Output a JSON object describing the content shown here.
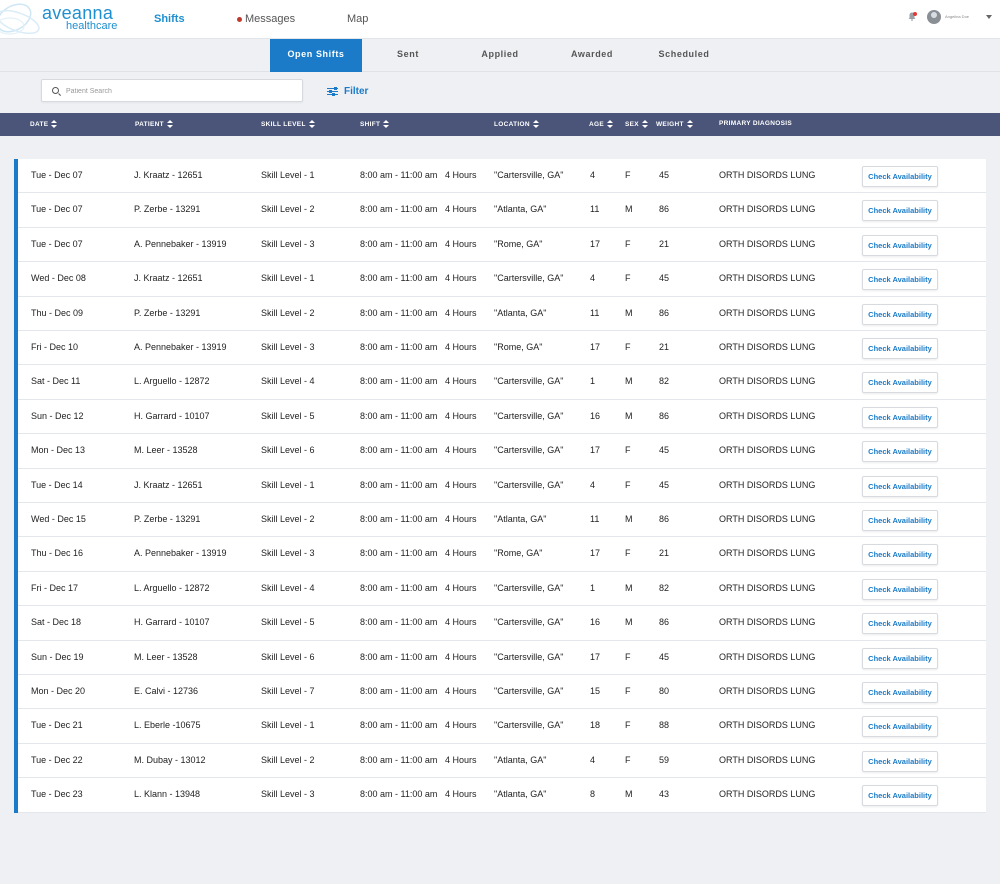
{
  "brand": {
    "name": "aveanna",
    "sub": "healthcare"
  },
  "nav": {
    "shifts": "Shifts",
    "messages": "Messages",
    "map": "Map"
  },
  "user": {
    "name": "Angelina Doe"
  },
  "tabs": [
    "Open Shifts",
    "Sent",
    "Applied",
    "Awarded",
    "Scheduled"
  ],
  "search": {
    "placeholder": "Patient Search",
    "value": ""
  },
  "filter_label": "Filter",
  "columns": [
    "DATE",
    "PATIENT",
    "SKILL LEVEL",
    "SHIFT",
    "LOCATION",
    "AGE",
    "SEX",
    "WEIGHT",
    "PRIMARY DIAGNOSIS"
  ],
  "action_label": "Check Availability",
  "colors": {
    "accent": "#1b7bc8",
    "header": "#4a5579",
    "background": "#eef0f4"
  },
  "rows": [
    {
      "date": "Tue - Dec 07",
      "patient": "J. Kraatz - 12651",
      "skill": "Skill Level - 1",
      "time": "8:00 am - 11:00 am",
      "hours": "4 Hours",
      "location": "\"Cartersville, GA\"",
      "age": "4",
      "sex": "F",
      "weight": "45",
      "diagnosis": "ORTH DISORDS LUNG"
    },
    {
      "date": "Tue - Dec 07",
      "patient": "P. Zerbe - 13291",
      "skill": "Skill Level - 2",
      "time": "8:00 am - 11:00 am",
      "hours": "4 Hours",
      "location": "\"Atlanta, GA\"",
      "age": "11",
      "sex": "M",
      "weight": "86",
      "diagnosis": "ORTH DISORDS LUNG"
    },
    {
      "date": "Tue - Dec 07",
      "patient": "A. Pennebaker - 13919",
      "skill": "Skill Level - 3",
      "time": "8:00 am - 11:00 am",
      "hours": "4 Hours",
      "location": "\"Rome, GA\"",
      "age": "17",
      "sex": "F",
      "weight": "21",
      "diagnosis": "ORTH DISORDS LUNG"
    },
    {
      "date": "Wed - Dec 08",
      "patient": "J. Kraatz - 12651",
      "skill": "Skill Level - 1",
      "time": "8:00 am - 11:00 am",
      "hours": "4 Hours",
      "location": "\"Cartersville, GA\"",
      "age": "4",
      "sex": "F",
      "weight": "45",
      "diagnosis": "ORTH DISORDS LUNG"
    },
    {
      "date": "Thu - Dec 09",
      "patient": "P. Zerbe - 13291",
      "skill": "Skill Level - 2",
      "time": "8:00 am - 11:00 am",
      "hours": "4 Hours",
      "location": "\"Atlanta, GA\"",
      "age": "11",
      "sex": "M",
      "weight": "86",
      "diagnosis": "ORTH DISORDS LUNG"
    },
    {
      "date": "Fri - Dec 10",
      "patient": "A. Pennebaker - 13919",
      "skill": "Skill Level - 3",
      "time": "8:00 am - 11:00 am",
      "hours": "4 Hours",
      "location": "\"Rome, GA\"",
      "age": "17",
      "sex": "F",
      "weight": "21",
      "diagnosis": "ORTH DISORDS LUNG"
    },
    {
      "date": "Sat - Dec 11",
      "patient": "L. Arguello - 12872",
      "skill": "Skill Level - 4",
      "time": "8:00 am - 11:00 am",
      "hours": "4 Hours",
      "location": "\"Cartersville, GA\"",
      "age": "1",
      "sex": "M",
      "weight": "82",
      "diagnosis": "ORTH DISORDS LUNG"
    },
    {
      "date": "Sun - Dec 12",
      "patient": "H. Garrard - 10107",
      "skill": "Skill Level - 5",
      "time": "8:00 am - 11:00 am",
      "hours": "4 Hours",
      "location": "\"Cartersville, GA\"",
      "age": "16",
      "sex": "M",
      "weight": "86",
      "diagnosis": "ORTH DISORDS LUNG"
    },
    {
      "date": "Mon - Dec 13",
      "patient": "M. Leer - 13528",
      "skill": "Skill Level - 6",
      "time": "8:00 am - 11:00 am",
      "hours": "4 Hours",
      "location": "\"Cartersville, GA\"",
      "age": "17",
      "sex": "F",
      "weight": "45",
      "diagnosis": "ORTH DISORDS LUNG"
    },
    {
      "date": "Tue - Dec 14",
      "patient": "J. Kraatz - 12651",
      "skill": "Skill Level - 1",
      "time": "8:00 am - 11:00 am",
      "hours": "4 Hours",
      "location": "\"Cartersville, GA\"",
      "age": "4",
      "sex": "F",
      "weight": "45",
      "diagnosis": "ORTH DISORDS LUNG"
    },
    {
      "date": "Wed - Dec 15",
      "patient": "P. Zerbe - 13291",
      "skill": "Skill Level - 2",
      "time": "8:00 am - 11:00 am",
      "hours": "4 Hours",
      "location": "\"Atlanta, GA\"",
      "age": "11",
      "sex": "M",
      "weight": "86",
      "diagnosis": "ORTH DISORDS LUNG"
    },
    {
      "date": "Thu - Dec 16",
      "patient": "A. Pennebaker - 13919",
      "skill": "Skill Level - 3",
      "time": "8:00 am - 11:00 am",
      "hours": "4 Hours",
      "location": "\"Rome, GA\"",
      "age": "17",
      "sex": "F",
      "weight": "21",
      "diagnosis": "ORTH DISORDS LUNG"
    },
    {
      "date": "Fri - Dec 17",
      "patient": "L. Arguello - 12872",
      "skill": "Skill Level - 4",
      "time": "8:00 am - 11:00 am",
      "hours": "4 Hours",
      "location": "\"Cartersville, GA\"",
      "age": "1",
      "sex": "M",
      "weight": "82",
      "diagnosis": "ORTH DISORDS LUNG"
    },
    {
      "date": "Sat - Dec 18",
      "patient": "H. Garrard - 10107",
      "skill": "Skill Level - 5",
      "time": "8:00 am - 11:00 am",
      "hours": "4 Hours",
      "location": "\"Cartersville, GA\"",
      "age": "16",
      "sex": "M",
      "weight": "86",
      "diagnosis": "ORTH DISORDS LUNG"
    },
    {
      "date": "Sun - Dec 19",
      "patient": "M. Leer - 13528",
      "skill": "Skill Level - 6",
      "time": "8:00 am - 11:00 am",
      "hours": "4 Hours",
      "location": "\"Cartersville, GA\"",
      "age": "17",
      "sex": "F",
      "weight": "45",
      "diagnosis": "ORTH DISORDS LUNG"
    },
    {
      "date": "Mon - Dec 20",
      "patient": "E. Calvi - 12736",
      "skill": "Skill Level - 7",
      "time": "8:00 am - 11:00 am",
      "hours": "4 Hours",
      "location": "\"Cartersville, GA\"",
      "age": "15",
      "sex": "F",
      "weight": "80",
      "diagnosis": "ORTH DISORDS LUNG"
    },
    {
      "date": "Tue - Dec 21",
      "patient": "L. Eberle -10675",
      "skill": "Skill Level - 1",
      "time": "8:00 am - 11:00 am",
      "hours": "4 Hours",
      "location": "\"Cartersville, GA\"",
      "age": "18",
      "sex": "F",
      "weight": "88",
      "diagnosis": "ORTH DISORDS LUNG"
    },
    {
      "date": "Tue - Dec 22",
      "patient": "M. Dubay - 13012",
      "skill": "Skill Level - 2",
      "time": "8:00 am - 11:00 am",
      "hours": "4 Hours",
      "location": "\"Atlanta, GA\"",
      "age": "4",
      "sex": "F",
      "weight": "59",
      "diagnosis": "ORTH DISORDS LUNG"
    },
    {
      "date": "Tue - Dec 23",
      "patient": "L. Klann - 13948",
      "skill": "Skill Level - 3",
      "time": "8:00 am - 11:00 am",
      "hours": "4 Hours",
      "location": "\"Atlanta, GA\"",
      "age": "8",
      "sex": "M",
      "weight": "43",
      "diagnosis": "ORTH DISORDS LUNG"
    }
  ]
}
